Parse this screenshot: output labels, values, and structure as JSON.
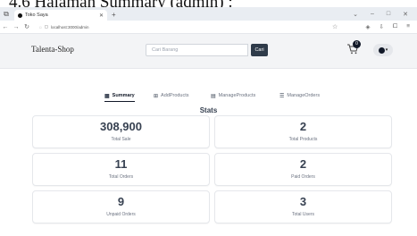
{
  "caption": "4.6 Halaman Summary (admin) :",
  "browser": {
    "tab_title": "Toko Saya",
    "url": "localhost:3000/admin",
    "window_controls": [
      "⌄",
      "–",
      "□",
      "✕"
    ]
  },
  "navbar": {
    "brand": "Talenta-Shop",
    "search_placeholder": "Cari Barang",
    "search_button": "Cari",
    "cart_count": "0"
  },
  "tabs": [
    {
      "label": "Summary",
      "icon": "grid-icon",
      "glyph": "▦",
      "active": true
    },
    {
      "label": "AddProducts",
      "icon": "add-icon",
      "glyph": "⊞",
      "active": false
    },
    {
      "label": "ManageProducts",
      "icon": "list-icon",
      "glyph": "▤",
      "active": false
    },
    {
      "label": "ManageOrders",
      "icon": "orders-icon",
      "glyph": "☰",
      "active": false
    }
  ],
  "stats": {
    "title": "Stats",
    "cards": [
      {
        "value": "308,900",
        "label": "Total Sale"
      },
      {
        "value": "2",
        "label": "Total Products"
      },
      {
        "value": "11",
        "label": "Total Orders"
      },
      {
        "value": "2",
        "label": "Paid Orders"
      },
      {
        "value": "9",
        "label": "Unpaid Orders"
      },
      {
        "value": "3",
        "label": "Total Users"
      }
    ]
  }
}
